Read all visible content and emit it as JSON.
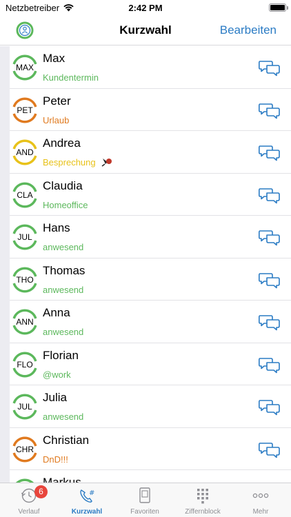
{
  "status_bar": {
    "carrier": "Netzbetreiber",
    "time": "2:42 PM"
  },
  "nav": {
    "title": "Kurzwahl",
    "edit_label": "Bearbeiten"
  },
  "colors": {
    "accent": "#2a7bc4",
    "green": "#5cb85c",
    "orange": "#e07a1f",
    "yellow": "#e8c21a"
  },
  "contacts": [
    {
      "abbr": "MAX",
      "name": "Max",
      "status": "Kundentermin",
      "status_color": "#5cb85c",
      "ring_color": "#5cb85c"
    },
    {
      "abbr": "PET",
      "name": "Peter",
      "status": "Urlaub",
      "status_color": "#e07a1f",
      "ring_color": "#e07a1f"
    },
    {
      "abbr": "AND",
      "name": "Andrea",
      "status": "Besprechung",
      "status_color": "#e8c21a",
      "ring_color": "#e8c21a",
      "status_icon": "microphone-icon"
    },
    {
      "abbr": "CLA",
      "name": "Claudia",
      "status": "Homeoffice",
      "status_color": "#5cb85c",
      "ring_color": "#5cb85c"
    },
    {
      "abbr": "JUL",
      "name": "Hans",
      "status": "anwesend",
      "status_color": "#5cb85c",
      "ring_color": "#5cb85c"
    },
    {
      "abbr": "THO",
      "name": "Thomas",
      "status": "anwesend",
      "status_color": "#5cb85c",
      "ring_color": "#5cb85c"
    },
    {
      "abbr": "ANN",
      "name": "Anna",
      "status": "anwesend",
      "status_color": "#5cb85c",
      "ring_color": "#5cb85c"
    },
    {
      "abbr": "FLO",
      "name": "Florian",
      "status": "@work",
      "status_color": "#5cb85c",
      "ring_color": "#5cb85c"
    },
    {
      "abbr": "JUL",
      "name": "Julia",
      "status": "anwesend",
      "status_color": "#5cb85c",
      "ring_color": "#5cb85c"
    },
    {
      "abbr": "CHR",
      "name": "Christian",
      "status": "DnD!!!",
      "status_color": "#e07a1f",
      "ring_color": "#e07a1f"
    },
    {
      "abbr": "",
      "name": "Markus",
      "status": "",
      "status_color": "#5cb85c",
      "ring_color": "#5cb85c"
    }
  ],
  "tabs": [
    {
      "label": "Verlauf",
      "icon": "history-icon",
      "badge": "6",
      "active": false
    },
    {
      "label": "Kurzwahl",
      "icon": "speed-dial-icon",
      "active": true
    },
    {
      "label": "Favoriten",
      "icon": "favorites-icon",
      "active": false
    },
    {
      "label": "Ziffernblock",
      "icon": "keypad-icon",
      "active": false
    },
    {
      "label": "Mehr",
      "icon": "more-icon",
      "active": false
    }
  ]
}
